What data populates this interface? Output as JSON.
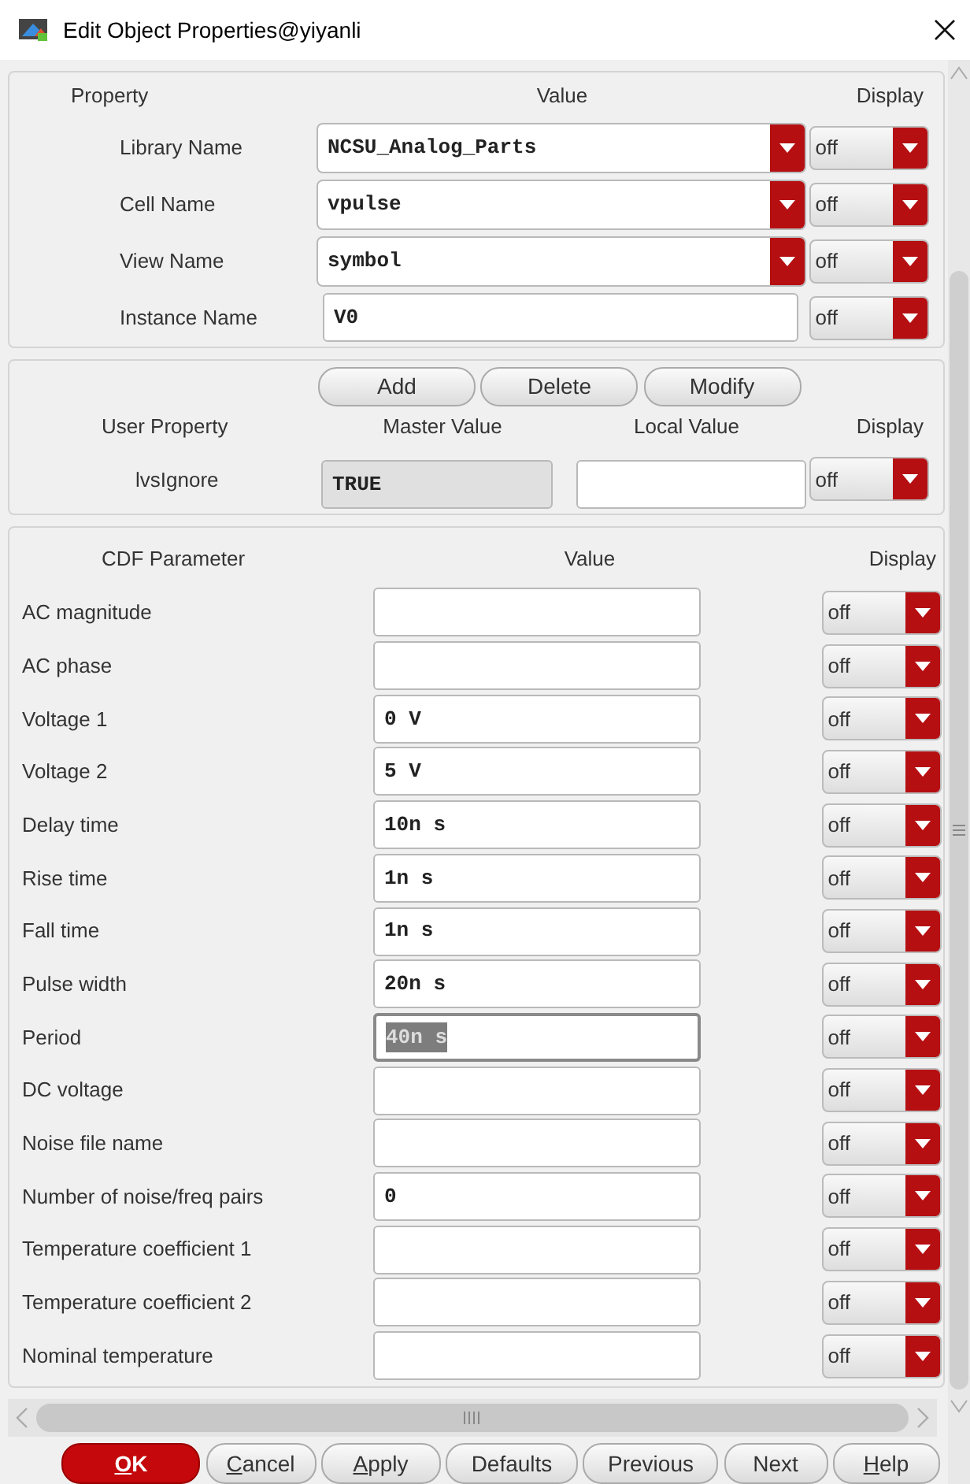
{
  "window": {
    "title": "Edit Object Properties@yiyanli"
  },
  "property_section": {
    "headers": [
      "Property",
      "Value",
      "Display"
    ],
    "rows": [
      {
        "label": "Library Name",
        "kind": "combo",
        "value": "NCSU_Analog_Parts",
        "display": "off"
      },
      {
        "label": "Cell Name",
        "kind": "combo",
        "value": "vpulse",
        "display": "off"
      },
      {
        "label": "View Name",
        "kind": "combo",
        "value": "symbol",
        "display": "off"
      },
      {
        "label": "Instance Name",
        "kind": "text",
        "value": "V0",
        "display": "off"
      }
    ]
  },
  "user_property_section": {
    "buttons": [
      "Add",
      "Delete",
      "Modify"
    ],
    "headers": [
      "User Property",
      "Master Value",
      "Local Value",
      "Display"
    ],
    "rows": [
      {
        "label": "lvsIgnore",
        "master_value": "TRUE",
        "display": "off"
      }
    ]
  },
  "cdf_section": {
    "headers": [
      "CDF Parameter",
      "Value",
      "Display"
    ],
    "rows": [
      {
        "label": "AC magnitude",
        "display": "off",
        "selected": false
      },
      {
        "label": "AC phase",
        "display": "off",
        "selected": false
      },
      {
        "label": "Voltage 1",
        "value": "0 V",
        "display": "off",
        "selected": false
      },
      {
        "label": "Voltage 2",
        "value": "5 V",
        "display": "off",
        "selected": false
      },
      {
        "label": "Delay time",
        "value": "10n s",
        "display": "off",
        "selected": false
      },
      {
        "label": "Rise time",
        "value": "1n s",
        "display": "off",
        "selected": false
      },
      {
        "label": "Fall time",
        "value": "1n s",
        "display": "off",
        "selected": false
      },
      {
        "label": "Pulse width",
        "value": "20n s",
        "display": "off",
        "selected": false
      },
      {
        "label": "Period",
        "value": "40n s",
        "display": "off",
        "selected": true
      },
      {
        "label": "DC voltage",
        "display": "off",
        "selected": false
      },
      {
        "label": "Noise file name",
        "display": "off",
        "selected": false
      },
      {
        "label": "Number of noise/freq pairs",
        "value": "0",
        "display": "off",
        "selected": false
      },
      {
        "label": "Temperature coefficient 1",
        "display": "off",
        "selected": false
      },
      {
        "label": "Temperature coefficient 2",
        "display": "off",
        "selected": false
      },
      {
        "label": "Nominal temperature",
        "display": "off",
        "selected": false
      }
    ]
  },
  "buttons": [
    {
      "label": "OK",
      "kind": "primary",
      "mnemonic": true
    },
    {
      "label": "Cancel",
      "kind": "normal",
      "mnemonic": true
    },
    {
      "label": "Apply",
      "kind": "normal",
      "mnemonic": true
    },
    {
      "label": "Defaults",
      "kind": "normal",
      "mnemonic": false
    },
    {
      "label": "Previous",
      "kind": "normal",
      "mnemonic": false
    },
    {
      "label": "Next",
      "kind": "normal",
      "mnemonic": false
    },
    {
      "label": "Help",
      "kind": "normal",
      "mnemonic": true
    }
  ]
}
